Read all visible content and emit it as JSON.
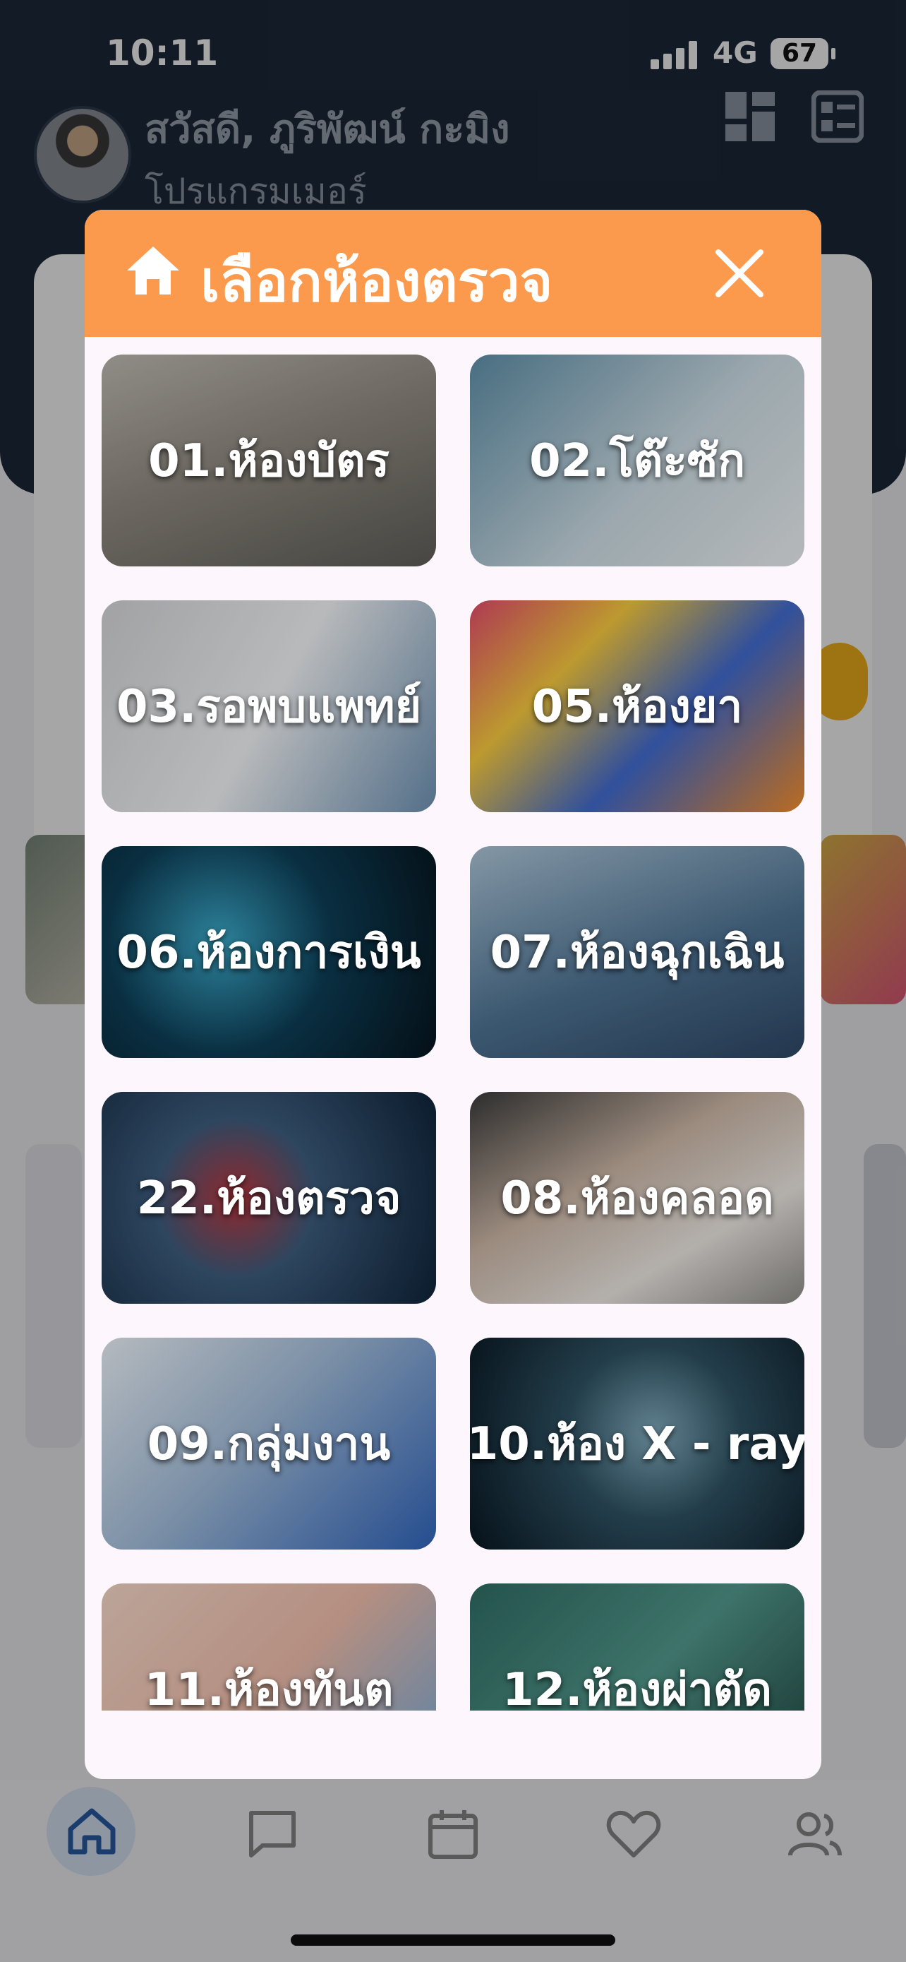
{
  "status_bar": {
    "time": "10:11",
    "network": "4G",
    "battery": "67"
  },
  "header": {
    "greeting": "สวัสดี, ภูริพัฒน์ กะมิง",
    "role": "โปรแกรมเมอร์"
  },
  "modal": {
    "title": "เลือกห้องตรวจ",
    "rooms": [
      {
        "label": "01.ห้องบัตร"
      },
      {
        "label": "02.โต๊ะซัก"
      },
      {
        "label": "03.รอพบแพทย์"
      },
      {
        "label": "05.ห้องยา"
      },
      {
        "label": "06.ห้องการเงิน"
      },
      {
        "label": "07.ห้องฉุกเฉิน"
      },
      {
        "label": "22.ห้องตรวจ"
      },
      {
        "label": "08.ห้องคลอด"
      },
      {
        "label": "09.กลุ่มงาน"
      },
      {
        "label": "10.ห้อง X - ray"
      },
      {
        "label": "11.ห้องทันต"
      },
      {
        "label": "12.ห้องผ่าตัด"
      }
    ]
  },
  "colors": {
    "accent": "#fb9a4d",
    "header_bg": "#1d2a3a",
    "modal_bg": "#fdf7fd"
  },
  "icons": [
    "home-icon",
    "close-icon",
    "grid-view-icon",
    "list-view-icon",
    "chat-icon",
    "calendar-icon",
    "heart-icon",
    "people-icon"
  ]
}
